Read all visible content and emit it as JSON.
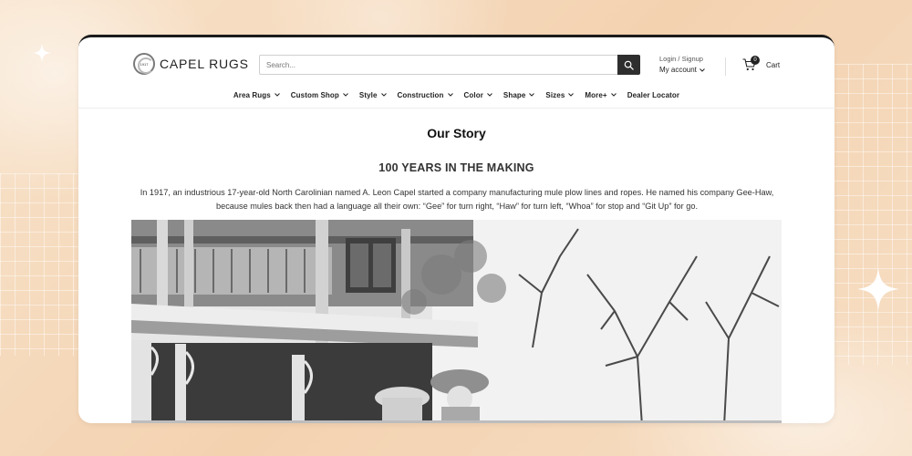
{
  "brand": {
    "name": "CAPEL RUGS",
    "mark_text": "1917"
  },
  "search": {
    "placeholder": "Search..."
  },
  "account": {
    "login_label": "Login / Signup",
    "account_label": "My account"
  },
  "cart": {
    "count": "0",
    "label": "Cart"
  },
  "nav": {
    "items": [
      {
        "label": "Area Rugs"
      },
      {
        "label": "Custom Shop"
      },
      {
        "label": "Style"
      },
      {
        "label": "Construction"
      },
      {
        "label": "Color"
      },
      {
        "label": "Shape"
      },
      {
        "label": "Sizes"
      },
      {
        "label": "More+"
      },
      {
        "label": "Dealer Locator"
      }
    ]
  },
  "story": {
    "title": "Our Story",
    "subtitle": "100 YEARS IN THE MAKING",
    "body": "In 1917, an industrious 17-year-old North Carolinian named A. Leon Capel started a company manufacturing mule plow lines and ropes. He named his company Gee-Haw, because mules back then had a language all their own: “Gee” for turn right, “Haw” for turn left, “Whoa” for stop and “Git Up” for go."
  },
  "icons": {
    "search": "search-icon",
    "cart": "cart-icon",
    "chevron": "chevron-down-icon",
    "sparkle": "sparkle-icon"
  },
  "colors": {
    "background": "#f6dcc0",
    "card": "#ffffff",
    "search_button": "#2e2e2e",
    "text": "#222222"
  }
}
